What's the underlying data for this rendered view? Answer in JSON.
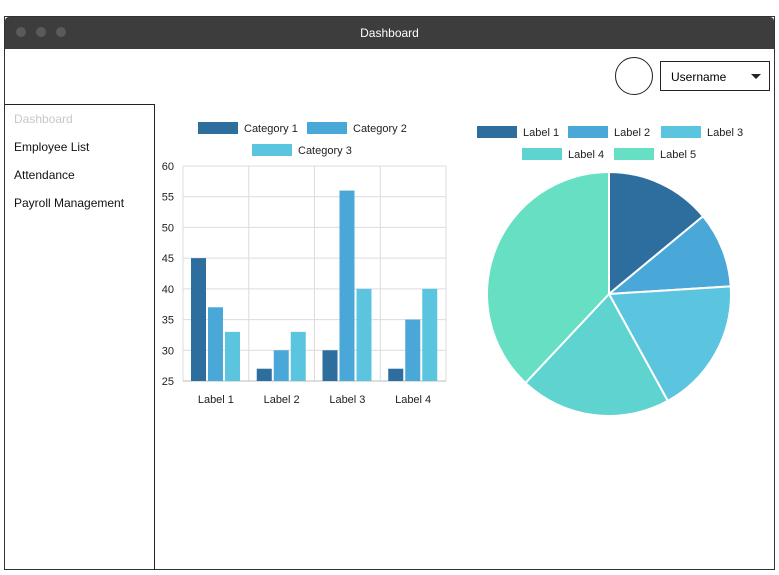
{
  "window": {
    "title": "Dashboard"
  },
  "header": {
    "username": "Username"
  },
  "sidebar": {
    "items": [
      {
        "label": "Dashboard",
        "active": true
      },
      {
        "label": "Employee List",
        "active": false
      },
      {
        "label": "Attendance",
        "active": false
      },
      {
        "label": "Payroll Management",
        "active": false
      }
    ]
  },
  "colors": {
    "c1": "#2d6e9e",
    "c2": "#4aa8d8",
    "c3": "#5bc5e0",
    "c4": "#5fd3cf",
    "c5": "#66dfc2"
  },
  "chart_data": [
    {
      "type": "bar",
      "categories": [
        "Label 1",
        "Label 2",
        "Label 3",
        "Label 4"
      ],
      "series": [
        {
          "name": "Category 1",
          "values": [
            45,
            27,
            30,
            27
          ]
        },
        {
          "name": "Category 2",
          "values": [
            37,
            30,
            56,
            35
          ]
        },
        {
          "name": "Category 3",
          "values": [
            33,
            33,
            40,
            40
          ]
        }
      ],
      "ylim": [
        25,
        60
      ],
      "yticks": [
        25,
        30,
        35,
        40,
        45,
        50,
        55,
        60
      ],
      "grid": true,
      "legend": "top"
    },
    {
      "type": "pie",
      "labels": [
        "Label 1",
        "Label 2",
        "Label 3",
        "Label 4",
        "Label 5"
      ],
      "values": [
        14,
        10,
        18,
        20,
        38
      ],
      "legend": "top"
    }
  ]
}
